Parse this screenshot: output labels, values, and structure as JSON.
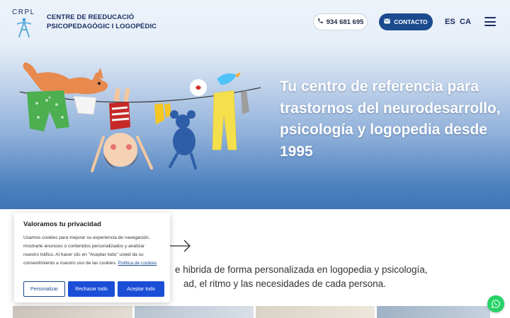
{
  "header": {
    "logo_text": "CRPL",
    "org_line1": "CENTRE DE REEDUCACIÓ",
    "org_line2": "PSICOPEDAGÒGIC I LOGOPÈDIC",
    "phone": "934 681 695",
    "contact_label": "CONTACTO",
    "languages": [
      "ES",
      "CA"
    ]
  },
  "hero": {
    "title": "Tu centro de referencia para trastornos del neurodesarrollo, psicología y logopedia desde 1995"
  },
  "body": {
    "line1": "e hibrida de forma personalizada en logopedia y psicología,",
    "line2": "ad, el ritmo y las necesidades de cada persona."
  },
  "cookie": {
    "title": "Valoramos tu privacidad",
    "text": "Usamos cookies para mejorar su experiencia de navegación, mostrarle anuncios o contenidos personalizados y analizar nuestro tráfico. Al hacer clic en \"Aceptar todo\" usted da su consentimiento a nuestro uso de las cookies.",
    "policy_link": "Política de cookies",
    "btn_customize": "Personalizar",
    "btn_reject": "Rechazar todo",
    "btn_accept": "Aceptar todo"
  },
  "colors": {
    "brand_navy": "#1a2e63",
    "button_blue": "#1b4a8e",
    "cookie_button_blue": "#1b4ed6",
    "whatsapp_green": "#25d366"
  },
  "icons": [
    "phone-icon",
    "mail-icon",
    "menu-icon",
    "arrow-right-icon",
    "whatsapp-icon"
  ]
}
